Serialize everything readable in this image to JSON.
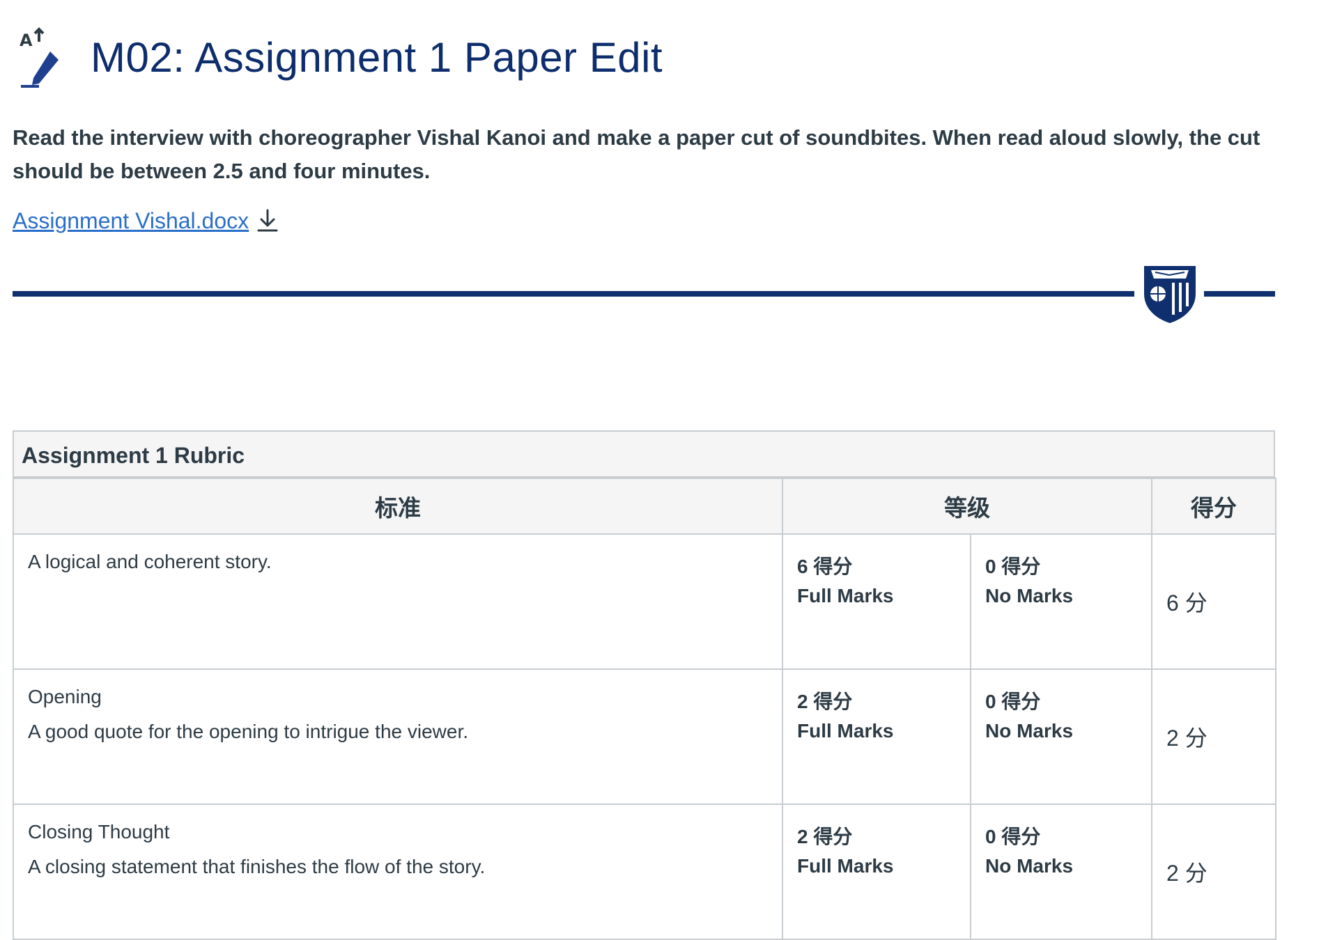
{
  "page": {
    "title": "M02: Assignment 1 Paper Edit",
    "intro": "Read the interview with choreographer Vishal Kanoi and make a paper cut of soundbites.  When read aloud slowly, the cut should be between 2.5 and four minutes.",
    "file_link": "Assignment Vishal.docx",
    "header_icon": "assignment-pencil-icon",
    "download_icon": "download-icon",
    "logo": "university-shield-logo"
  },
  "colors": {
    "title": "#0d2d6c",
    "divider": "#102f6e",
    "link": "#2a6fc9",
    "text": "#2d3b45",
    "table_border": "#c7cdd1",
    "table_header_bg": "#f5f5f5"
  },
  "rubric": {
    "caption": "Assignment 1 Rubric",
    "headers": {
      "criteria": "标准",
      "ratings": "等级",
      "points": "得分"
    },
    "rows": [
      {
        "title": "A logical and coherent story.",
        "description": "",
        "rating1_pts": "6 得分",
        "rating1_desc": "Full Marks",
        "rating2_pts": "0 得分",
        "rating2_desc": "No Marks",
        "points": "6 分"
      },
      {
        "title": "Opening",
        "description": "A good quote for the opening to intrigue the viewer.",
        "rating1_pts": "2 得分",
        "rating1_desc": "Full Marks",
        "rating2_pts": "0 得分",
        "rating2_desc": "No Marks",
        "points": "2 分"
      },
      {
        "title": "Closing Thought",
        "description": "A closing statement that finishes the flow of the story.",
        "rating1_pts": "2 得分",
        "rating1_desc": "Full Marks",
        "rating2_pts": "0 得分",
        "rating2_desc": "No Marks",
        "points": "2 分"
      }
    ]
  }
}
